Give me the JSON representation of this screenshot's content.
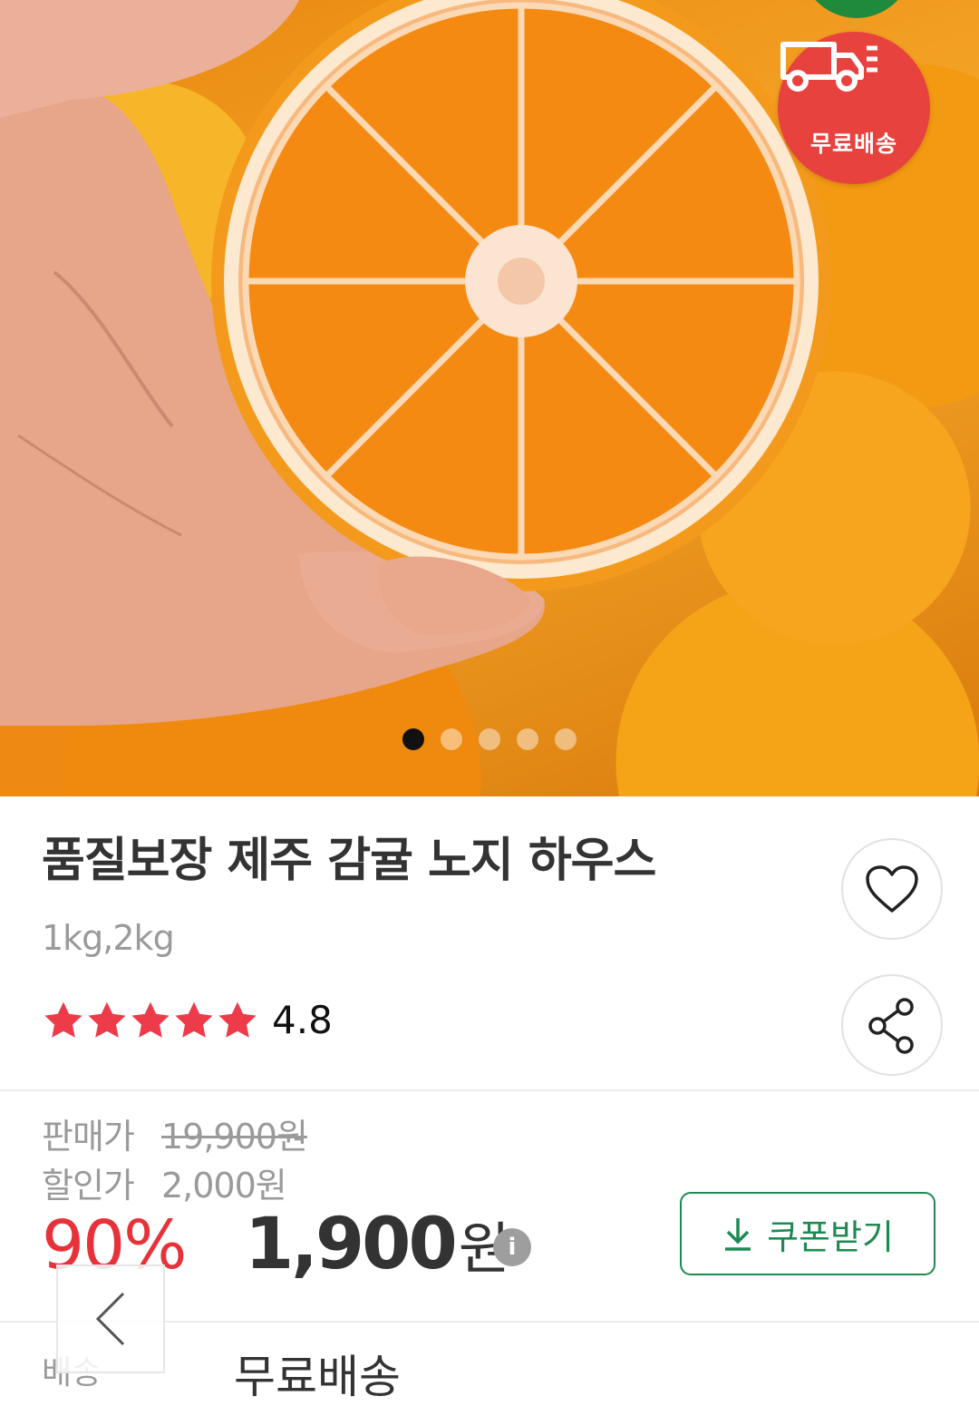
{
  "hero": {
    "image_alt": "",
    "badge_text": "무료배송",
    "slide_count": 5,
    "active_slide": 0
  },
  "product": {
    "title": "품질보장 제주 감귤 노지 하우스",
    "option": "1kg,2kg",
    "rating": {
      "value": "4.8",
      "stars": 5
    }
  },
  "price": {
    "sale_label": "판매가",
    "sale_value": "19,900원",
    "discount_label": "할인가",
    "discount_value": "2,000원",
    "discount_percent": "90%",
    "final_number": "1,900",
    "final_unit": "원",
    "info_symbol": "i",
    "coupon_label": "쿠폰받기"
  },
  "shipping": {
    "label": "배송",
    "value": "무료배송"
  },
  "colors": {
    "discount": "#e8323a",
    "star": "#ee3b4a",
    "coupon": "#1e8a52",
    "badge": "#e8423f"
  }
}
